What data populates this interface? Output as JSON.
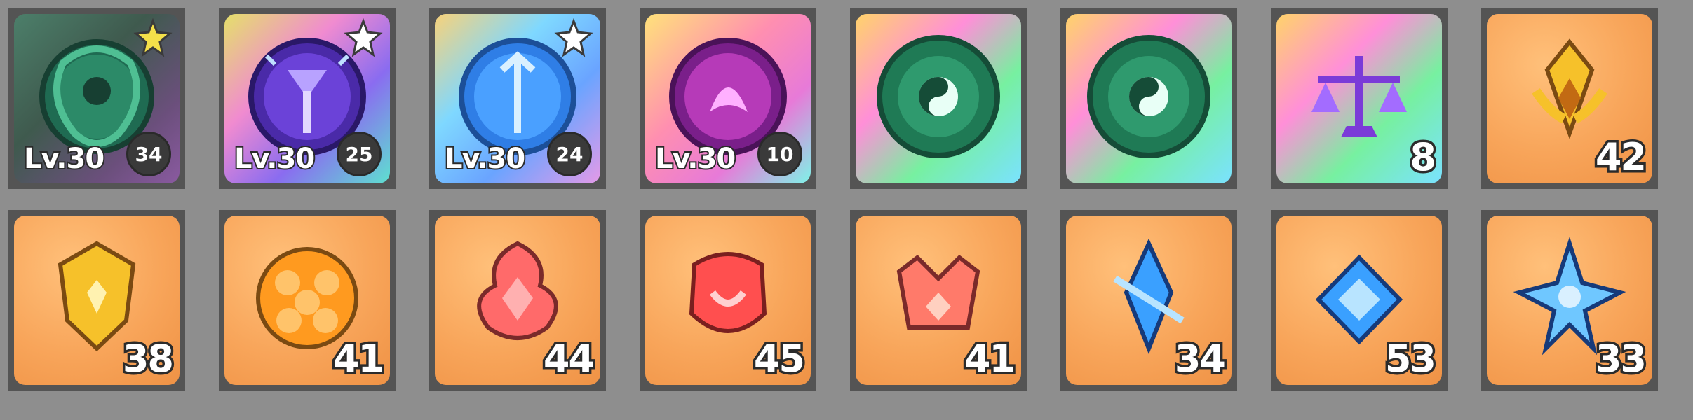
{
  "inventory": {
    "row1": [
      {
        "lv": "Lv.30",
        "rank": "34"
      },
      {
        "lv": "Lv.30",
        "rank": "25"
      },
      {
        "lv": "Lv.30",
        "rank": "24"
      },
      {
        "lv": "Lv.30",
        "rank": "10"
      },
      {
        "count": ""
      },
      {
        "count": ""
      },
      {
        "count": "8"
      },
      {
        "count": "42"
      }
    ],
    "row2": [
      {
        "count": "38"
      },
      {
        "count": "41"
      },
      {
        "count": "44"
      },
      {
        "count": "45"
      },
      {
        "count": "41"
      },
      {
        "count": "34"
      },
      {
        "count": "53"
      },
      {
        "count": "33"
      }
    ]
  }
}
